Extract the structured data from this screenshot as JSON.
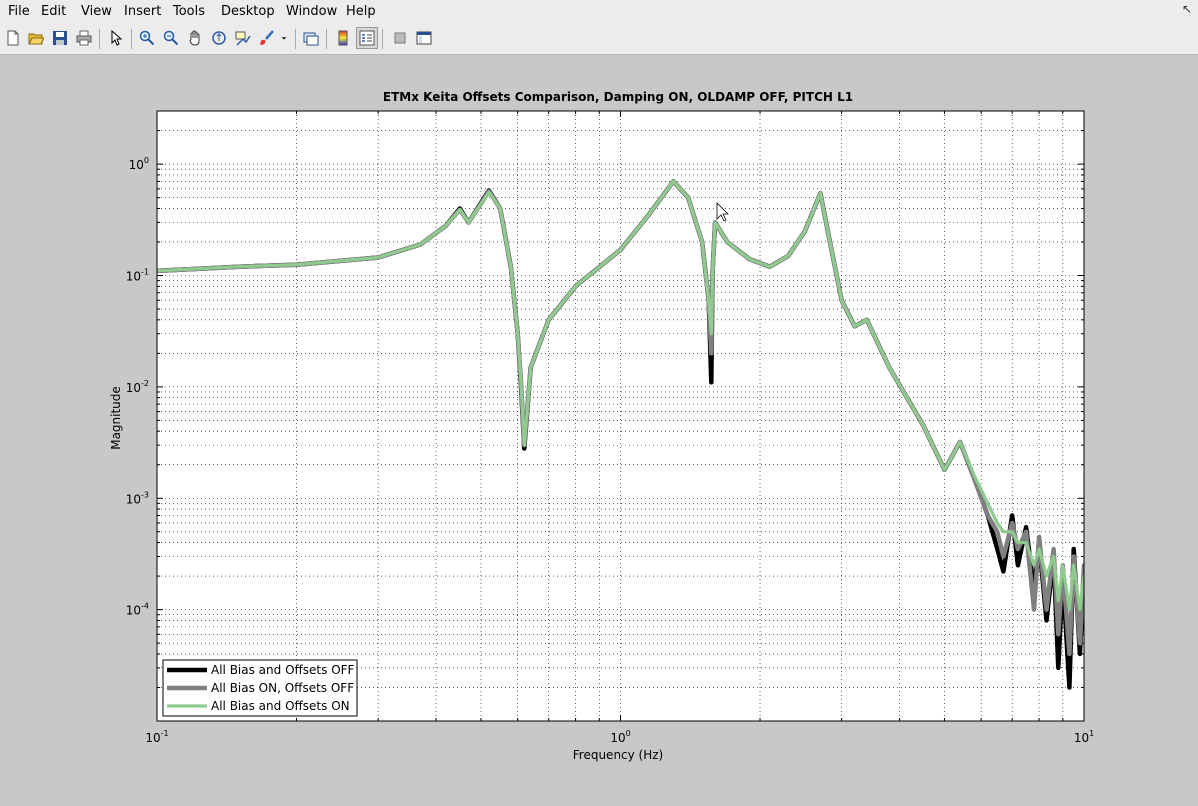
{
  "window": {
    "menu": [
      "File",
      "Edit",
      "View",
      "Insert",
      "Tools",
      "Desktop",
      "Window",
      "Help"
    ],
    "close_glyph": "↖"
  },
  "toolbar": {
    "buttons": [
      "new-figure-icon",
      "open-file-icon",
      "save-icon",
      "print-icon",
      "edit-plot-arrow-icon",
      "zoom-in-icon",
      "zoom-out-icon",
      "pan-hand-icon",
      "rotate-3d-icon",
      "data-cursor-icon",
      "brush-icon",
      "brush-dropdown-icon",
      "link-plot-icon",
      "colorbar-icon",
      "legend-icon",
      "hide-plot-tools-icon",
      "show-plot-tools-icon"
    ]
  },
  "colors": {
    "figure_bg": "#c8c8c8",
    "axes_bg": "#ffffff",
    "series_off": "#000000",
    "series_bias_on": "#808080",
    "series_all_on": "#8fca8f"
  },
  "chart_data": {
    "type": "line",
    "title": "ETMx Keita Offsets Comparison, Damping ON, OLDAMP OFF, PITCH L1",
    "xlabel": "Frequency (Hz)",
    "ylabel": "Magnitude",
    "xscale": "log",
    "yscale": "log",
    "xlim": [
      0.1,
      10
    ],
    "ylim": [
      1e-05,
      3
    ],
    "x_ticks": [
      {
        "value": 0.1,
        "base": "10",
        "exp": "-1"
      },
      {
        "value": 1,
        "base": "10",
        "exp": "0"
      },
      {
        "value": 10,
        "base": "10",
        "exp": "1"
      }
    ],
    "y_ticks": [
      {
        "value": 0.0001,
        "base": "10",
        "exp": "-4"
      },
      {
        "value": 0.001,
        "base": "10",
        "exp": "-3"
      },
      {
        "value": 0.01,
        "base": "10",
        "exp": "-2"
      },
      {
        "value": 0.1,
        "base": "10",
        "exp": "-1"
      },
      {
        "value": 1,
        "base": "10",
        "exp": "0"
      }
    ],
    "grid": true,
    "legend_position": "bottom-left",
    "series": [
      {
        "name": "All Bias and Offsets OFF",
        "color": "#000000",
        "linewidth": 4.5,
        "x": [
          0.1,
          0.15,
          0.2,
          0.3,
          0.37,
          0.42,
          0.45,
          0.47,
          0.5,
          0.52,
          0.55,
          0.58,
          0.6,
          0.61,
          0.62,
          0.64,
          0.7,
          0.8,
          1.0,
          1.15,
          1.3,
          1.4,
          1.5,
          1.55,
          1.57,
          1.58,
          1.6,
          1.7,
          1.9,
          2.1,
          2.3,
          2.5,
          2.7,
          2.8,
          3.0,
          3.2,
          3.4,
          3.8,
          4.5,
          5.0,
          5.4,
          5.8,
          6.2,
          6.5,
          6.7,
          7.0,
          7.2,
          7.5,
          7.8,
          8.0,
          8.3,
          8.6,
          8.8,
          9.0,
          9.3,
          9.5,
          9.8,
          10.0
        ],
        "y": [
          0.11,
          0.12,
          0.125,
          0.145,
          0.19,
          0.28,
          0.4,
          0.3,
          0.45,
          0.58,
          0.4,
          0.12,
          0.03,
          0.01,
          0.0028,
          0.015,
          0.04,
          0.08,
          0.17,
          0.35,
          0.7,
          0.5,
          0.2,
          0.06,
          0.011,
          0.11,
          0.3,
          0.2,
          0.14,
          0.12,
          0.15,
          0.25,
          0.55,
          0.25,
          0.06,
          0.035,
          0.04,
          0.015,
          0.0045,
          0.0018,
          0.0032,
          0.0015,
          0.0007,
          0.00035,
          0.00022,
          0.0007,
          0.00025,
          0.00055,
          0.00015,
          0.0004,
          8e-05,
          0.0003,
          3e-05,
          0.0002,
          2e-05,
          0.00035,
          4e-05,
          0.0002
        ]
      },
      {
        "name": "All Bias ON, Offsets OFF",
        "color": "#808080",
        "linewidth": 4.5,
        "x": [
          0.1,
          0.15,
          0.2,
          0.3,
          0.37,
          0.42,
          0.45,
          0.47,
          0.5,
          0.52,
          0.55,
          0.58,
          0.6,
          0.61,
          0.62,
          0.64,
          0.7,
          0.8,
          1.0,
          1.15,
          1.3,
          1.4,
          1.5,
          1.55,
          1.57,
          1.58,
          1.6,
          1.7,
          1.9,
          2.1,
          2.3,
          2.5,
          2.7,
          2.8,
          3.0,
          3.2,
          3.4,
          3.8,
          4.5,
          5.0,
          5.4,
          5.8,
          6.2,
          6.5,
          6.7,
          7.0,
          7.2,
          7.5,
          7.8,
          8.0,
          8.3,
          8.6,
          8.8,
          9.0,
          9.3,
          9.5,
          9.8,
          10.0
        ],
        "y": [
          0.11,
          0.12,
          0.125,
          0.145,
          0.19,
          0.28,
          0.39,
          0.3,
          0.44,
          0.57,
          0.4,
          0.12,
          0.03,
          0.011,
          0.003,
          0.015,
          0.04,
          0.08,
          0.17,
          0.35,
          0.7,
          0.5,
          0.2,
          0.06,
          0.02,
          0.11,
          0.3,
          0.2,
          0.14,
          0.12,
          0.15,
          0.25,
          0.55,
          0.25,
          0.06,
          0.035,
          0.04,
          0.015,
          0.0045,
          0.0018,
          0.0032,
          0.0015,
          0.0007,
          0.0005,
          0.0003,
          0.0006,
          0.00035,
          0.0005,
          0.0001,
          0.00045,
          0.0001,
          0.00035,
          6e-05,
          0.00025,
          4e-05,
          0.0003,
          5e-05,
          0.00025
        ]
      },
      {
        "name": "All Bias and Offsets ON",
        "color": "#8fca8f",
        "linewidth": 3.2,
        "x": [
          0.1,
          0.15,
          0.2,
          0.3,
          0.37,
          0.42,
          0.45,
          0.47,
          0.5,
          0.52,
          0.55,
          0.58,
          0.6,
          0.61,
          0.62,
          0.64,
          0.7,
          0.8,
          1.0,
          1.15,
          1.3,
          1.4,
          1.5,
          1.55,
          1.57,
          1.58,
          1.6,
          1.7,
          1.9,
          2.1,
          2.3,
          2.5,
          2.7,
          2.8,
          3.0,
          3.2,
          3.4,
          3.8,
          4.5,
          5.0,
          5.4,
          5.8,
          6.2,
          6.5,
          6.7,
          7.0,
          7.2,
          7.5,
          7.8,
          8.0,
          8.3,
          8.6,
          8.8,
          9.0,
          9.3,
          9.5,
          9.8,
          10.0
        ],
        "y": [
          0.11,
          0.12,
          0.125,
          0.145,
          0.19,
          0.28,
          0.39,
          0.3,
          0.44,
          0.56,
          0.4,
          0.12,
          0.03,
          0.011,
          0.003,
          0.015,
          0.04,
          0.08,
          0.17,
          0.35,
          0.7,
          0.5,
          0.2,
          0.06,
          0.03,
          0.11,
          0.3,
          0.2,
          0.14,
          0.12,
          0.15,
          0.25,
          0.55,
          0.25,
          0.06,
          0.035,
          0.04,
          0.015,
          0.0045,
          0.0018,
          0.0032,
          0.0016,
          0.0009,
          0.0006,
          0.0005,
          0.0005,
          0.0004,
          0.0004,
          0.00025,
          0.00035,
          0.0002,
          0.0003,
          0.00012,
          0.00025,
          0.0001,
          0.00025,
          0.0001,
          0.0002
        ]
      }
    ]
  }
}
